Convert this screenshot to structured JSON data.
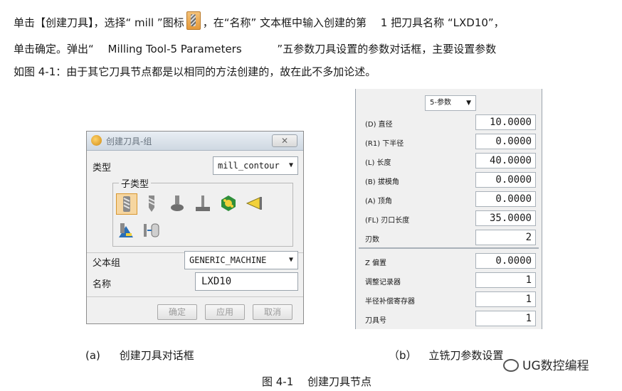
{
  "text": {
    "line1_a": "单击【创建刀具】，选择“ mill ”图标",
    "line1_b": "，在“名称” 文本框中输入创建的第　 1 把刀具名称 “LXD10”，",
    "line2": "单击确定。弹出“　 Milling Tool-5 Parameters　　　 ”五参数刀具设置的参数对话框，主要设置参数",
    "line3": "如图 4-1：由于其它刀具节点都是以相同的方法创建的，故在此不多加论述。"
  },
  "dialog": {
    "title": "创建刀具-组",
    "type_label": "类型",
    "type_value": "mill_contour",
    "subtype_label": "子类型",
    "subtypes": [
      "end-mill",
      "drill-mill",
      "ball-mill",
      "t-cutter",
      "barrel",
      "chamfer",
      "thread-mill",
      "tool-holder"
    ],
    "parent_label": "父本组",
    "parent_value": "GENERIC_MACHINE",
    "name_label": "名称",
    "name_value": "LXD10",
    "buttons": {
      "ok": "确定",
      "apply": "应用",
      "cancel": "取消"
    }
  },
  "params": {
    "dropdown": "5-参数",
    "rows": [
      {
        "label": "(D) 直径",
        "value": "10.0000"
      },
      {
        "label": "(R1) 下半径",
        "value": "0.0000"
      },
      {
        "label": "(L) 长度",
        "value": "40.0000"
      },
      {
        "label": "(B) 拔模角",
        "value": "0.0000"
      },
      {
        "label": "(A) 顶角",
        "value": "0.0000"
      },
      {
        "label": "(FL) 刃口长度",
        "value": "35.0000"
      },
      {
        "label": "刃数",
        "value": "2"
      },
      {
        "label": "Z 偏置",
        "value": "0.0000"
      },
      {
        "label": "调整记录器",
        "value": "1"
      },
      {
        "label": "半径补偿寄存器",
        "value": "1"
      },
      {
        "label": "刀具号",
        "value": "1"
      }
    ]
  },
  "captions": {
    "a_tag": "(a)",
    "a_text": "创建刀具对话框",
    "b_tag": "（b）",
    "b_text": "立铣刀参数设置",
    "figure": "图 4-1　 创建刀具节点"
  },
  "watermark": "UG数控编程"
}
